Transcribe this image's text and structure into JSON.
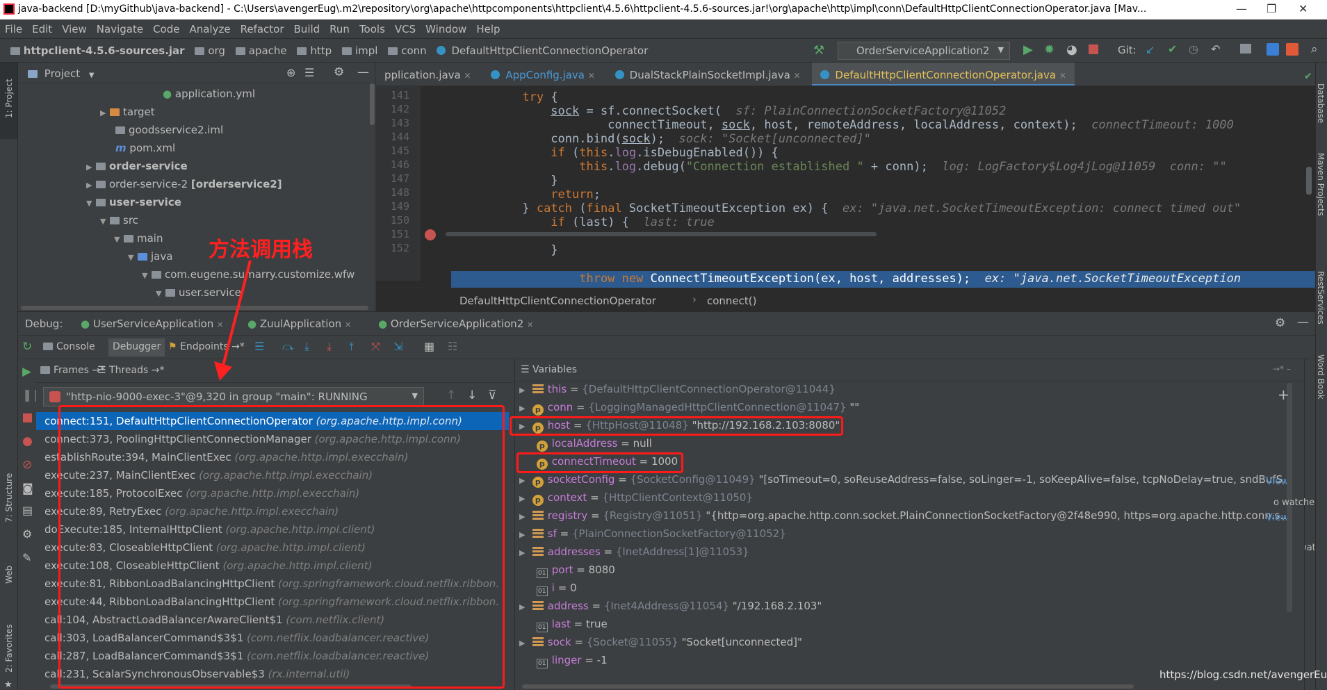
{
  "titlebar": {
    "title": "java-backend [D:\\myGithub\\java-backend] - C:\\Users\\avengerEug\\.m2\\repository\\org\\apache\\httpcomponents\\httpclient\\4.5.6\\httpclient-4.5.6-sources.jar!\\org\\apache\\http\\impl\\conn\\DefaultHttpClientConnectionOperator.java [Mav..."
  },
  "menu": [
    "File",
    "Edit",
    "View",
    "Navigate",
    "Code",
    "Analyze",
    "Refactor",
    "Build",
    "Run",
    "Tools",
    "VCS",
    "Window",
    "Help"
  ],
  "breadcrumbs": [
    "httpclient-4.5.6-sources.jar",
    "org",
    "apache",
    "http",
    "impl",
    "conn",
    "DefaultHttpClientConnectionOperator"
  ],
  "run_config": "OrderServiceApplication2",
  "git_label": "Git:",
  "left_strip": {
    "project": "1: Project",
    "structure": "7: Structure",
    "web": "Web",
    "favorites": "2: Favorites"
  },
  "right_strip": {
    "database": "Database",
    "maven": "Maven Projects",
    "rest": "RestServices",
    "wordbook": "Word Book"
  },
  "project": {
    "header": "Project",
    "rows": [
      {
        "label": "application.yml"
      },
      {
        "label": "target"
      },
      {
        "label": "goodsservice2.iml"
      },
      {
        "label": "pom.xml"
      },
      {
        "label": "order-service"
      },
      {
        "label": "order-service-2",
        "suffix": "[orderservice2]"
      },
      {
        "label": "user-service"
      },
      {
        "label": "src"
      },
      {
        "label": "main"
      },
      {
        "label": "java"
      },
      {
        "label": "com.eugene.sumarry.customize.wfw"
      },
      {
        "label": "user.service"
      }
    ]
  },
  "annotation": "方法调用栈",
  "editor": {
    "tabs": [
      "pplication.java",
      "AppConfig.java",
      "DualStackPlainSocketImpl.java",
      "DefaultHttpClientConnectionOperator.java"
    ],
    "line_numbers": [
      "141",
      "142",
      "143",
      "144",
      "145",
      "146",
      "147",
      "148",
      "149",
      "150",
      "151",
      "152"
    ],
    "code_breadcrumb": [
      "DefaultHttpClientConnectionOperator",
      "connect()"
    ]
  },
  "debug": {
    "label": "Debug:",
    "sessions": [
      "UserServiceApplication",
      "ZuulApplication",
      "OrderServiceApplication2"
    ],
    "tabs": [
      "Console",
      "Debugger",
      "Endpoints"
    ],
    "frames_tab": "Frames",
    "threads_tab": "Threads",
    "thread": "\"http-nio-9000-exec-3\"@9,320 in group \"main\": RUNNING",
    "frames": [
      {
        "method": "connect:151, DefaultHttpClientConnectionOperator",
        "pkg": "(org.apache.http.impl.conn)"
      },
      {
        "method": "connect:373, PoolingHttpClientConnectionManager",
        "pkg": "(org.apache.http.impl.conn)"
      },
      {
        "method": "establishRoute:394, MainClientExec",
        "pkg": "(org.apache.http.impl.execchain)"
      },
      {
        "method": "execute:237, MainClientExec",
        "pkg": "(org.apache.http.impl.execchain)"
      },
      {
        "method": "execute:185, ProtocolExec",
        "pkg": "(org.apache.http.impl.execchain)"
      },
      {
        "method": "execute:89, RetryExec",
        "pkg": "(org.apache.http.impl.execchain)"
      },
      {
        "method": "doExecute:185, InternalHttpClient",
        "pkg": "(org.apache.http.impl.client)"
      },
      {
        "method": "execute:83, CloseableHttpClient",
        "pkg": "(org.apache.http.impl.client)"
      },
      {
        "method": "execute:108, CloseableHttpClient",
        "pkg": "(org.apache.http.impl.client)"
      },
      {
        "method": "execute:81, RibbonLoadBalancingHttpClient",
        "pkg": "(org.springframework.cloud.netflix.ribbon."
      },
      {
        "method": "execute:44, RibbonLoadBalancingHttpClient",
        "pkg": "(org.springframework.cloud.netflix.ribbon."
      },
      {
        "method": "call:104, AbstractLoadBalancerAwareClient$1",
        "pkg": "(com.netflix.client)"
      },
      {
        "method": "call:303, LoadBalancerCommand$3$1",
        "pkg": "(com.netflix.loadbalancer.reactive)"
      },
      {
        "method": "call:287, LoadBalancerCommand$3$1",
        "pkg": "(com.netflix.loadbalancer.reactive)"
      },
      {
        "method": "call:231, ScalarSynchronousObservable$3",
        "pkg": "(rx.internal.util)"
      }
    ],
    "variables_label": "Variables",
    "variables": [
      {
        "name": "this",
        "type": "{DefaultHttpClientConnectionOperator@11044}",
        "value": ""
      },
      {
        "name": "conn",
        "type": "{LoggingManagedHttpClientConnection@11047}",
        "value": "\"\""
      },
      {
        "name": "host",
        "type": "{HttpHost@11048}",
        "value": "\"http://192.168.2.103:8080\""
      },
      {
        "name": "localAddress",
        "type": "",
        "value": "null"
      },
      {
        "name": "connectTimeout",
        "type": "",
        "value": "1000"
      },
      {
        "name": "socketConfig",
        "type": "{SocketConfig@11049}",
        "value": "\"[soTimeout=0, soReuseAddress=false, soLinger=-1, soKeepAlive=false, tcpNoDelay=true, sndBufS..."
      },
      {
        "name": "context",
        "type": "{HttpClientContext@11050}",
        "value": ""
      },
      {
        "name": "registry",
        "type": "{Registry@11051}",
        "value": "\"{http=org.apache.http.conn.socket.PlainConnectionSocketFactory@2f48e990, https=org.apache.http.conn.s..."
      },
      {
        "name": "sf",
        "type": "{PlainConnectionSocketFactory@11052}",
        "value": ""
      },
      {
        "name": "addresses",
        "type": "{InetAddress[1]@11053}",
        "value": ""
      },
      {
        "name": "port",
        "type": "",
        "value": "8080"
      },
      {
        "name": "i",
        "type": "",
        "value": "0"
      },
      {
        "name": "address",
        "type": "{Inet4Address@11054}",
        "value": "\"/192.168.2.103\""
      },
      {
        "name": "last",
        "type": "",
        "value": "true"
      },
      {
        "name": "sock",
        "type": "{Socket@11055}",
        "value": "\"Socket[unconnected]\""
      },
      {
        "name": "linger",
        "type": "",
        "value": "-1"
      }
    ],
    "view_link": "View",
    "watches_hint": "o watche",
    "footer_url": "https://blog.csdn.net/avengerEug"
  }
}
